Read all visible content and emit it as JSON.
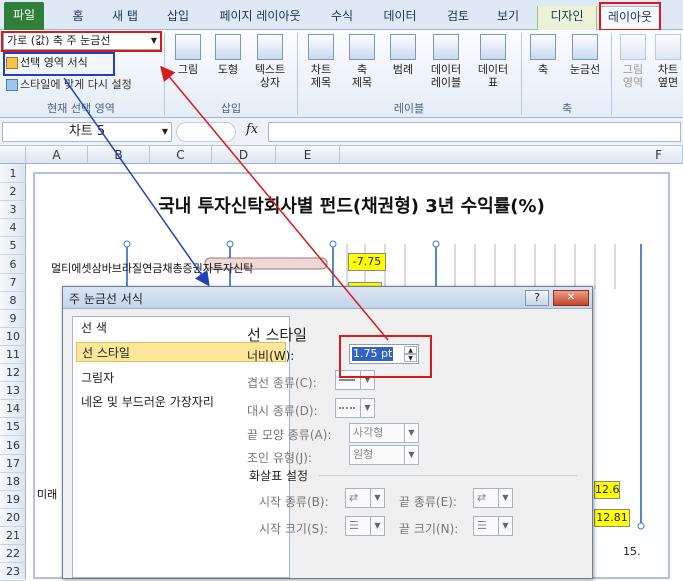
{
  "tabs": {
    "file": "파일",
    "items": [
      "홈",
      "새 탭",
      "삽입",
      "페이지 레이아웃",
      "수식",
      "데이터",
      "검토",
      "보기",
      "디자인",
      "레이아웃"
    ]
  },
  "ribbon": {
    "selection_dropdown": "가로 (값) 축 주 눈금선",
    "format_selection": "선택 영역 서식",
    "reset_style": "스타일에 맞게 다시 설정",
    "group_current": "현재 선택 영역",
    "group_insert": "삽입",
    "group_labels": "레이블",
    "group_axes": "축",
    "insert_picture": "그림",
    "insert_shape": "도형",
    "insert_textbox_1": "텍스트",
    "insert_textbox_2": "상자",
    "chart_title_1": "차트",
    "chart_title_2": "제목",
    "axis_title_1": "축",
    "axis_title_2": "제목",
    "legend": "범례",
    "data_labels_1": "데이터",
    "data_labels_2": "레이블",
    "data_table_1": "데이터",
    "data_table_2": "표",
    "axes": "축",
    "gridlines": "눈금선",
    "plot_area_1": "그림",
    "plot_area_2": "영역",
    "chart_wall_1": "차트",
    "chart_wall_2": "옆면"
  },
  "formula_bar": {
    "name_box": "차트 5",
    "fx": "fx"
  },
  "columns": [
    "A",
    "B",
    "C",
    "D",
    "E",
    "F"
  ],
  "rows": [
    "1",
    "2",
    "3",
    "4",
    "5",
    "6",
    "7",
    "8",
    "9",
    "10",
    "11",
    "12",
    "13",
    "14",
    "15",
    "16",
    "17",
    "18",
    "19",
    "20",
    "21",
    "22",
    "23"
  ],
  "chart": {
    "title": "국내 투자신탁회사별 펀드(채권형) 3년 수익률(%)",
    "row6_label": "멀티에셋삼바브라질연금채총증권자투자신탁",
    "row19_label": "미래",
    "data_labels": [
      "-7.75",
      "12.6",
      "12.81",
      "15."
    ]
  },
  "dialog": {
    "title": "주 눈금선 서식",
    "help": "?",
    "close": "✕",
    "nav": [
      "선 색",
      "선 스타일",
      "그림자",
      "네온 및 부드러운 가장자리"
    ],
    "section_title": "선 스타일",
    "width_label": "너비(W):",
    "width_value": "1.75 pt",
    "compound_label": "겹선 종류(C):",
    "dash_label": "대시 종류(D):",
    "cap_label": "끝 모양 종류(A):",
    "cap_value": "사각형",
    "join_label": "조인 유형(J):",
    "join_value": "원형",
    "arrow_header": "화살표 설정",
    "begin_type": "시작 종류(B):",
    "end_type": "끝 종류(E):",
    "begin_size": "시작 크기(S):",
    "end_size": "끝 크기(N):"
  },
  "colors": {
    "file_tab": "#2f7f3a",
    "highlight": "#d91a1a",
    "annotation_blue": "#2040c0",
    "data_label": "#ffff00",
    "nav_selected": "#fbe69a"
  }
}
